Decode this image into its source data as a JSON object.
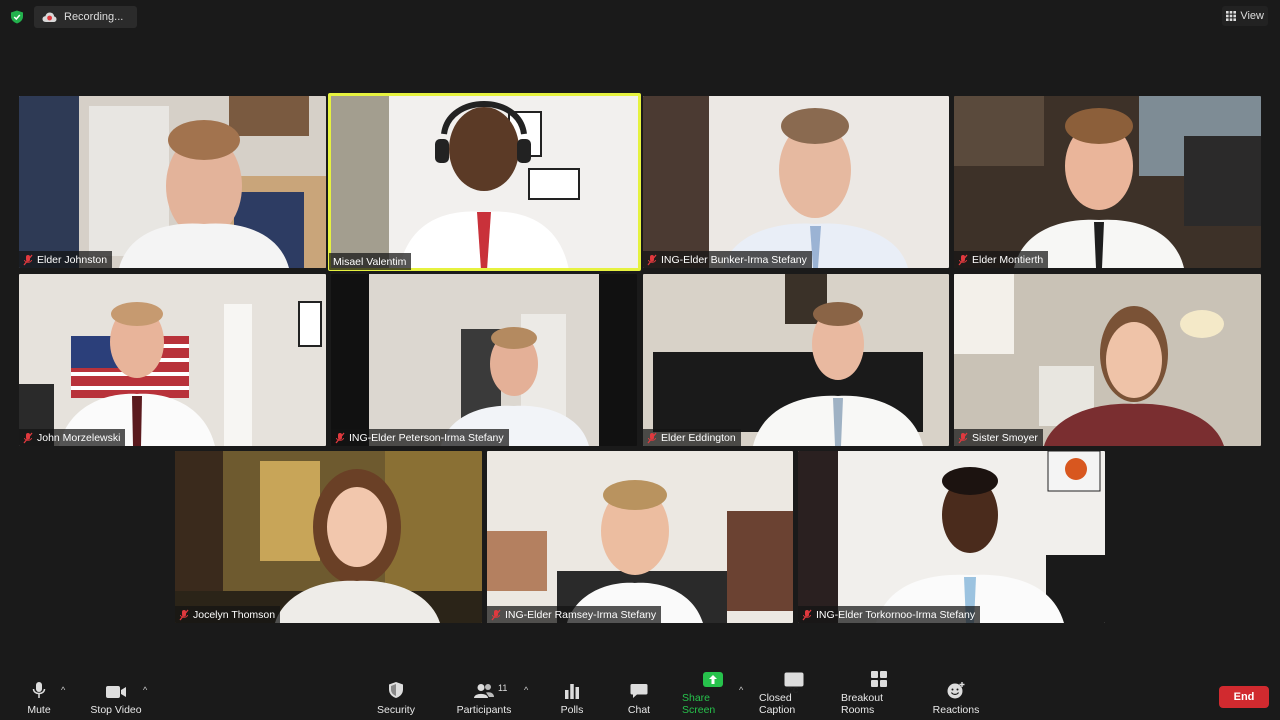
{
  "status": {
    "recording_label": "Recording...",
    "view_label": "View"
  },
  "participants": [
    {
      "name": "Elder Johnston",
      "muted": true,
      "active": false
    },
    {
      "name": "Misael Valentim",
      "muted": false,
      "active": true
    },
    {
      "name": "ING-Elder Bunker-Irma Stefany",
      "muted": true,
      "active": false
    },
    {
      "name": "Elder Montierth",
      "muted": true,
      "active": false
    },
    {
      "name": "John Morzelewski",
      "muted": true,
      "active": false
    },
    {
      "name": "ING-Elder Peterson-Irma Stefany",
      "muted": true,
      "active": false
    },
    {
      "name": "Elder Eddington",
      "muted": true,
      "active": false
    },
    {
      "name": "Sister Smoyer",
      "muted": true,
      "active": false
    },
    {
      "name": "Jocelyn Thomson",
      "muted": true,
      "active": false
    },
    {
      "name": "ING-Elder Ramsey-Irma Stefany",
      "muted": true,
      "active": false
    },
    {
      "name": "ING-Elder Torkornoo-Irma Stefany",
      "muted": true,
      "active": false
    }
  ],
  "toolbar": {
    "mute_label": "Mute",
    "stop_video_label": "Stop Video",
    "security_label": "Security",
    "participants_label": "Participants",
    "participants_count": "11",
    "polls_label": "Polls",
    "chat_label": "Chat",
    "share_screen_label": "Share Screen",
    "closed_caption_label": "Closed Caption",
    "breakout_rooms_label": "Breakout Rooms",
    "reactions_label": "Reactions",
    "end_label": "End",
    "cc_icon_text": "CC"
  },
  "colors": {
    "active_speaker": "#e6f23f",
    "share_green": "#27c24c",
    "end_red": "#d12a2f",
    "muted_red": "#e0393e"
  }
}
